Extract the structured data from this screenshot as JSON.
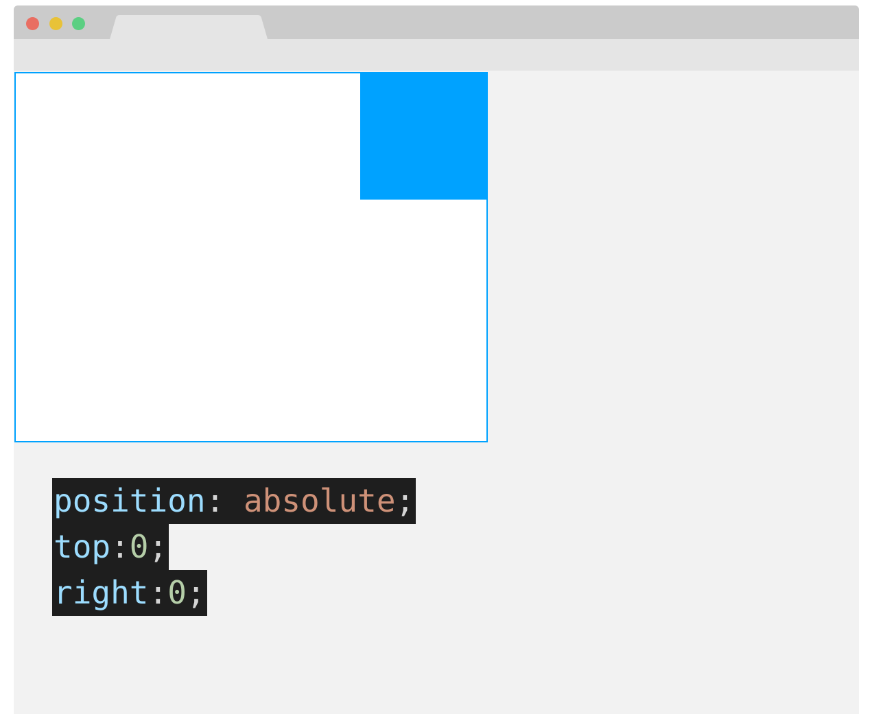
{
  "window": {
    "traffic_lights": {
      "close_color": "#e96e62",
      "minimize_color": "#e8c238",
      "zoom_color": "#5bcf82"
    },
    "tab_label": ""
  },
  "demo": {
    "container_border_color": "#00a2ff",
    "box_color": "#00a2ff"
  },
  "code": {
    "colors": {
      "property": "#9cdcfe",
      "punct": "#d4d4d4",
      "string": "#ce9178",
      "number": "#b5cea8",
      "background": "#1e1e1e"
    },
    "lines": [
      {
        "property": "position",
        "colon": ": ",
        "value": "absolute",
        "value_kind": "string",
        "semicolon": ";"
      },
      {
        "property": "top",
        "colon": ":",
        "value": "0",
        "value_kind": "number",
        "semicolon": ";"
      },
      {
        "property": "right",
        "colon": ":",
        "value": "0",
        "value_kind": "number",
        "semicolon": ";"
      }
    ]
  }
}
